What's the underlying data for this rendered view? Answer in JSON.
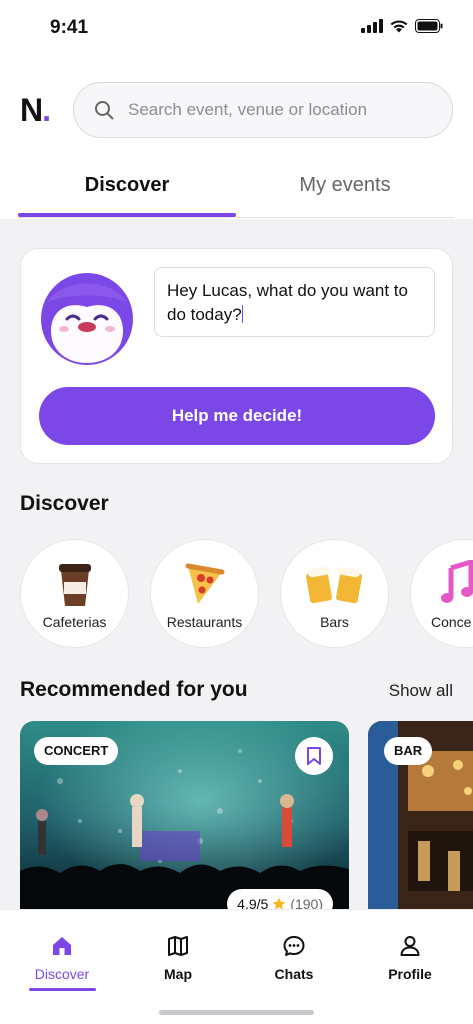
{
  "status": {
    "time": "9:41"
  },
  "header": {
    "logo_letter": "N",
    "logo_dot": ".",
    "search_placeholder": "Search event, venue or location"
  },
  "tabs": [
    {
      "label": "Discover",
      "active": true
    },
    {
      "label": "My events",
      "active": false
    }
  ],
  "assistant": {
    "message": "Hey Lucas, what do you want to do today?",
    "button_label": "Help me decide!"
  },
  "discover": {
    "title": "Discover",
    "categories": [
      {
        "label": "Cafeterias",
        "icon": "coffee-cup-icon"
      },
      {
        "label": "Restaurants",
        "icon": "pizza-icon"
      },
      {
        "label": "Bars",
        "icon": "beer-mugs-icon"
      },
      {
        "label": "Conce",
        "icon": "music-note-icon"
      }
    ]
  },
  "recommended": {
    "title": "Recommended for you",
    "show_all": "Show all",
    "cards": [
      {
        "tag": "CONCERT",
        "rating": "4.9/5",
        "reviews": "(190)"
      },
      {
        "tag": "BAR"
      }
    ]
  },
  "nav": [
    {
      "label": "Discover",
      "icon": "home-icon",
      "active": true
    },
    {
      "label": "Map",
      "icon": "map-icon",
      "active": false
    },
    {
      "label": "Chats",
      "icon": "chat-icon",
      "active": false
    },
    {
      "label": "Profile",
      "icon": "profile-icon",
      "active": false
    }
  ],
  "colors": {
    "accent": "#7b47e6",
    "background": "#f2f2f4"
  }
}
